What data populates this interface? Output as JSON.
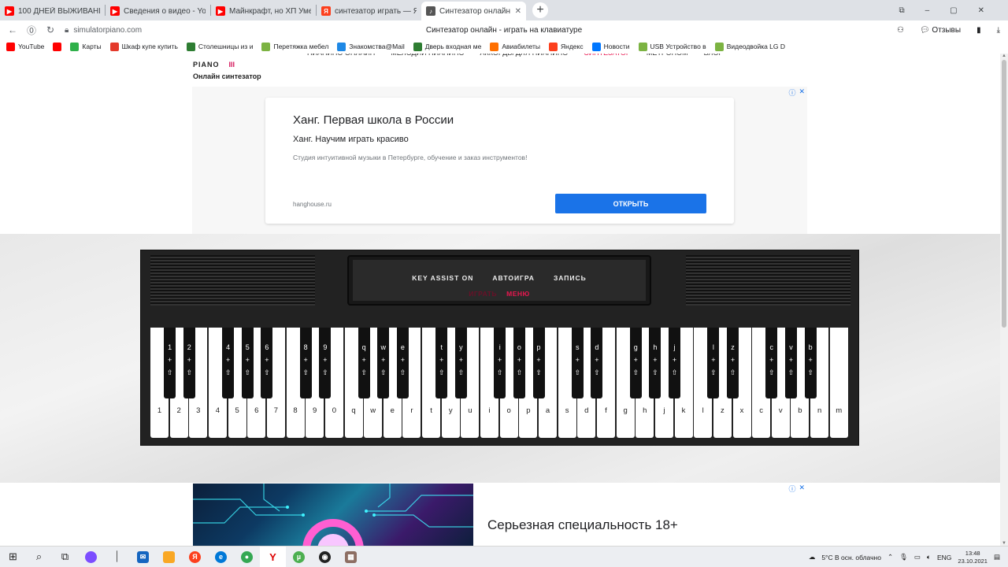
{
  "browser": {
    "tabs": [
      {
        "title": "100 ДНЕЙ ВЫЖИВАНИ",
        "favicon": "youtube-icon",
        "color": "#ff0000"
      },
      {
        "title": "Сведения о видео - YouTu",
        "favicon": "youtube-icon",
        "color": "#ff0000"
      },
      {
        "title": "Майнкрафт, но ХП Уме",
        "favicon": "youtube-icon",
        "color": "#ff0000"
      },
      {
        "title": "синтезатор играть — Янде",
        "favicon": "yandex-icon",
        "color": "#fc3f1d"
      },
      {
        "title": "Синтезатор онлайн",
        "favicon": "piano-icon",
        "color": "#555555"
      }
    ],
    "url": "simulatorpiano.com",
    "page_title": "Синтезатор онлайн - играть на клавиатуре",
    "feedback_label": "Отзывы",
    "bookmarks": [
      {
        "label": "YouTube",
        "color": "#ff0000"
      },
      {
        "label": "",
        "color": "#ff0000"
      },
      {
        "label": "Карты",
        "color": "#2fb04a"
      },
      {
        "label": "Шкаф купе купить",
        "color": "#e43a2b"
      },
      {
        "label": "Столешницы из и",
        "color": "#2e7d32"
      },
      {
        "label": "Перетяжка мебел",
        "color": "#7cb342"
      },
      {
        "label": "Знакомства@Mail",
        "color": "#1e88e5"
      },
      {
        "label": "Дверь входная ме",
        "color": "#2e7d32"
      },
      {
        "label": "Авиабилеты",
        "color": "#ff6f00"
      },
      {
        "label": "Яндекс",
        "color": "#fc3f1d"
      },
      {
        "label": "Новости",
        "color": "#0077ff"
      },
      {
        "label": "USB Устройство в",
        "color": "#7cb342"
      },
      {
        "label": "Видеодвойка LG D",
        "color": "#7cb342"
      }
    ]
  },
  "site": {
    "logo_text": "PIANO",
    "logo_marks": "III",
    "logo_subtitle": "Онлайн синтезатор",
    "nav": [
      "ПИАНИНО ОНЛАЙН",
      "МЕЛОДИИ ПИАНИНО",
      "АККОРДЫ ДЛЯ ПИАНИНО",
      "СИНТЕЗАТОР",
      "МЕТРОНОМ",
      "БЛОГ"
    ]
  },
  "ad_top": {
    "headline": "Ханг. Первая школа в России",
    "subheadline": "Ханг. Научим играть красиво",
    "description": "Студия интуитивной музыки в Петербурге, обучение и заказ инструментов!",
    "domain": "hanghouse.ru",
    "button": "ОТКРЫТЬ"
  },
  "synth": {
    "menu_row1": [
      "KEY ASSIST ON",
      "АВТОИГРА",
      "ЗАПИСЬ"
    ],
    "play_label": "ИГРАТЬ",
    "menu_label": "МЕНЮ",
    "white_keys": [
      "1",
      "2",
      "3",
      "4",
      "5",
      "6",
      "7",
      "8",
      "9",
      "0",
      "q",
      "w",
      "e",
      "r",
      "t",
      "y",
      "u",
      "i",
      "o",
      "p",
      "a",
      "s",
      "d",
      "f",
      "g",
      "h",
      "j",
      "k",
      "l",
      "z",
      "x",
      "c",
      "v",
      "b",
      "n",
      "m"
    ],
    "black_keys": [
      "1",
      "2",
      "4",
      "5",
      "6",
      "8",
      "9",
      "q",
      "w",
      "e",
      "t",
      "y",
      "i",
      "o",
      "p",
      "s",
      "d",
      "g",
      "h",
      "j",
      "l",
      "z",
      "c",
      "v",
      "b"
    ],
    "black_modifiers": [
      "+",
      "⇧"
    ]
  },
  "ad_bottom": {
    "headline": "Серьезная специальность 18+"
  },
  "taskbar": {
    "weather": "5°C  В осн. облачно",
    "lang": "ENG",
    "time": "13:48",
    "date": "23.10.2021"
  },
  "colors": {
    "accent_red": "#e8174f",
    "ad_button": "#1a73e8",
    "synth_body": "#222222"
  }
}
